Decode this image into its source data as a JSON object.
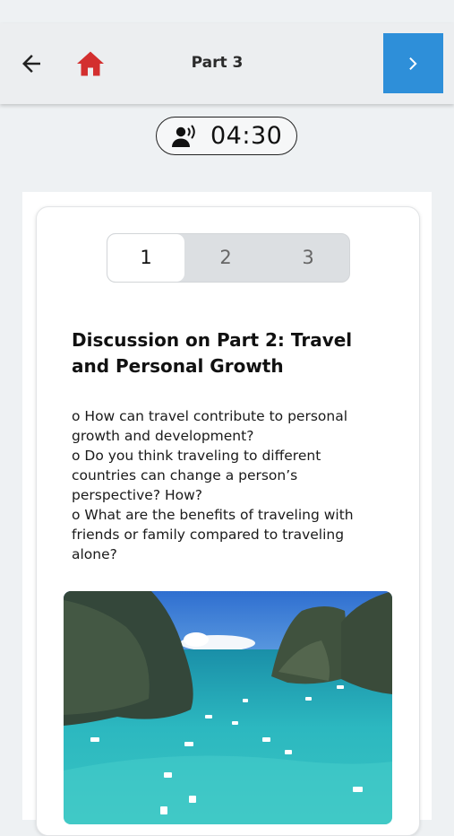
{
  "header": {
    "title": "Part 3",
    "back_icon": "arrow-left-icon",
    "home_icon": "home-icon",
    "next_icon": "chevron-right-icon",
    "accent": "#2e8fd9",
    "home_color": "#d32f2f"
  },
  "timer": {
    "icon": "speaking-person-icon",
    "value": "04:30"
  },
  "tabs": [
    {
      "label": "1",
      "active": true
    },
    {
      "label": "2",
      "active": false
    },
    {
      "label": "3",
      "active": false
    }
  ],
  "card": {
    "title": "Discussion on Part 2: Travel and Personal Growth",
    "questions": [
      "o How can travel contribute to personal growth and development?",
      "o Do you think traveling to different countries can change a person’s perspective? How?",
      "o What are the benefits of traveling with friends or family compared to traveling alone?"
    ]
  }
}
